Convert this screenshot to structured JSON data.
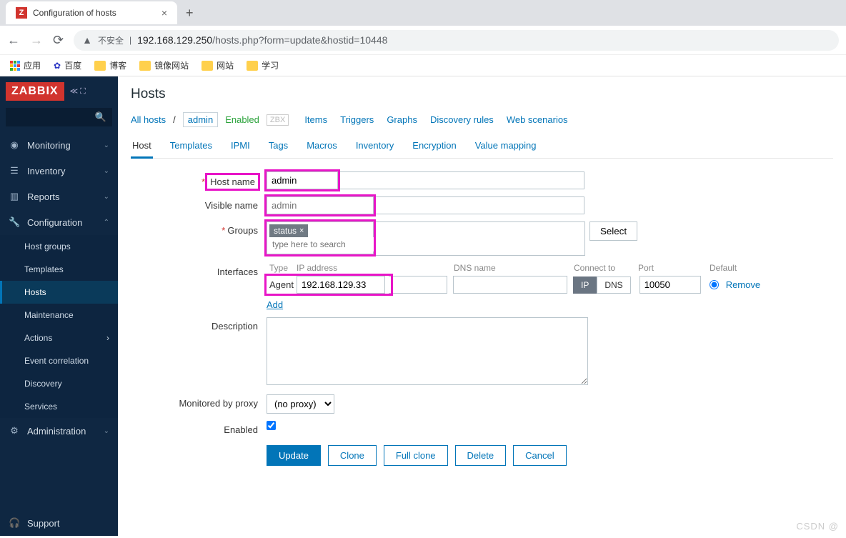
{
  "browser": {
    "tab_title": "Configuration of hosts",
    "url_insecure_label": "不安全",
    "url_host": "192.168.129.250",
    "url_path": "/hosts.php?form=update&hostid=10448",
    "apps_label": "应用",
    "bookmarks": [
      "百度",
      "博客",
      "镜像网站",
      "网站",
      "学习"
    ]
  },
  "sidebar": {
    "logo": "ZABBIX",
    "items": [
      {
        "label": "Monitoring",
        "icon": "eye"
      },
      {
        "label": "Inventory",
        "icon": "list"
      },
      {
        "label": "Reports",
        "icon": "bar"
      },
      {
        "label": "Configuration",
        "icon": "wrench"
      },
      {
        "label": "Administration",
        "icon": "gear"
      }
    ],
    "config_sub": [
      "Host groups",
      "Templates",
      "Hosts",
      "Maintenance",
      "Actions",
      "Event correlation",
      "Discovery",
      "Services"
    ],
    "support": "Support"
  },
  "page": {
    "title": "Hosts",
    "breadcrumb": {
      "all": "All hosts",
      "current": "admin"
    },
    "status": "Enabled",
    "zbx": "ZBX",
    "toplinks": [
      "Items",
      "Triggers",
      "Graphs",
      "Discovery rules",
      "Web scenarios"
    ],
    "tabs": [
      "Host",
      "Templates",
      "IPMI",
      "Tags",
      "Macros",
      "Inventory",
      "Encryption",
      "Value mapping"
    ]
  },
  "form": {
    "labels": {
      "host_name": "Host name",
      "visible_name": "Visible name",
      "groups": "Groups",
      "interfaces": "Interfaces",
      "description": "Description",
      "monitored_by": "Monitored by proxy",
      "enabled": "Enabled"
    },
    "host_name": "admin",
    "visible_name_placeholder": "admin",
    "visible_name": "",
    "group_tag": "status",
    "group_search_placeholder": "type here to search",
    "select_btn": "Select",
    "iface_headers": {
      "type": "Type",
      "ip": "IP address",
      "dns": "DNS name",
      "connect": "Connect to",
      "port": "Port",
      "default": "Default"
    },
    "iface": {
      "type": "Agent",
      "ip": "192.168.129.33",
      "dns": "",
      "conn_ip": "IP",
      "conn_dns": "DNS",
      "port": "10050",
      "remove": "Remove"
    },
    "add": "Add",
    "description": "",
    "proxy": "(no proxy)",
    "enabled": true,
    "buttons": {
      "update": "Update",
      "clone": "Clone",
      "full_clone": "Full clone",
      "delete": "Delete",
      "cancel": "Cancel"
    }
  },
  "watermark": "CSDN @  "
}
